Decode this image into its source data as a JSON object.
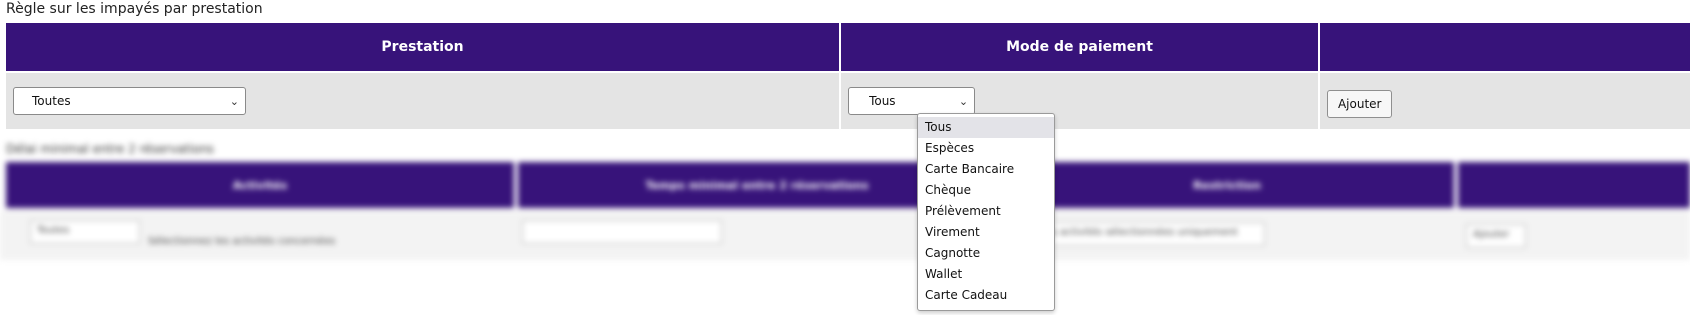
{
  "section_title": "Règle sur les impayés par prestation",
  "table": {
    "headers": {
      "prestation": "Prestation",
      "mode_paiement": "Mode de paiement",
      "actions": ""
    },
    "prestation_value": "Toutes",
    "mode_paiement_value": "Tous",
    "add_button": "Ajouter"
  },
  "dropdown": {
    "options": [
      "Tous",
      "Espèces",
      "Carte Bancaire",
      "Chèque",
      "Prélèvement",
      "Virement",
      "Cagnotte",
      "Wallet",
      "Carte Cadeau"
    ],
    "selected": "Tous"
  },
  "blurred_section": {
    "title": "Délai minimal entre 2 réservations",
    "headers": [
      "Activités",
      "Temps minimal entre 2 réservations",
      "Restriction",
      ""
    ],
    "row": {
      "activity": "Toutes",
      "note": "Sélectionnez les activités concernées",
      "restriction": "Restreindre les activités sélectionnées uniquement",
      "button": "Ajouter"
    }
  },
  "colors": {
    "header_bg": "#37137a",
    "row_bg": "#e4e4e4"
  }
}
